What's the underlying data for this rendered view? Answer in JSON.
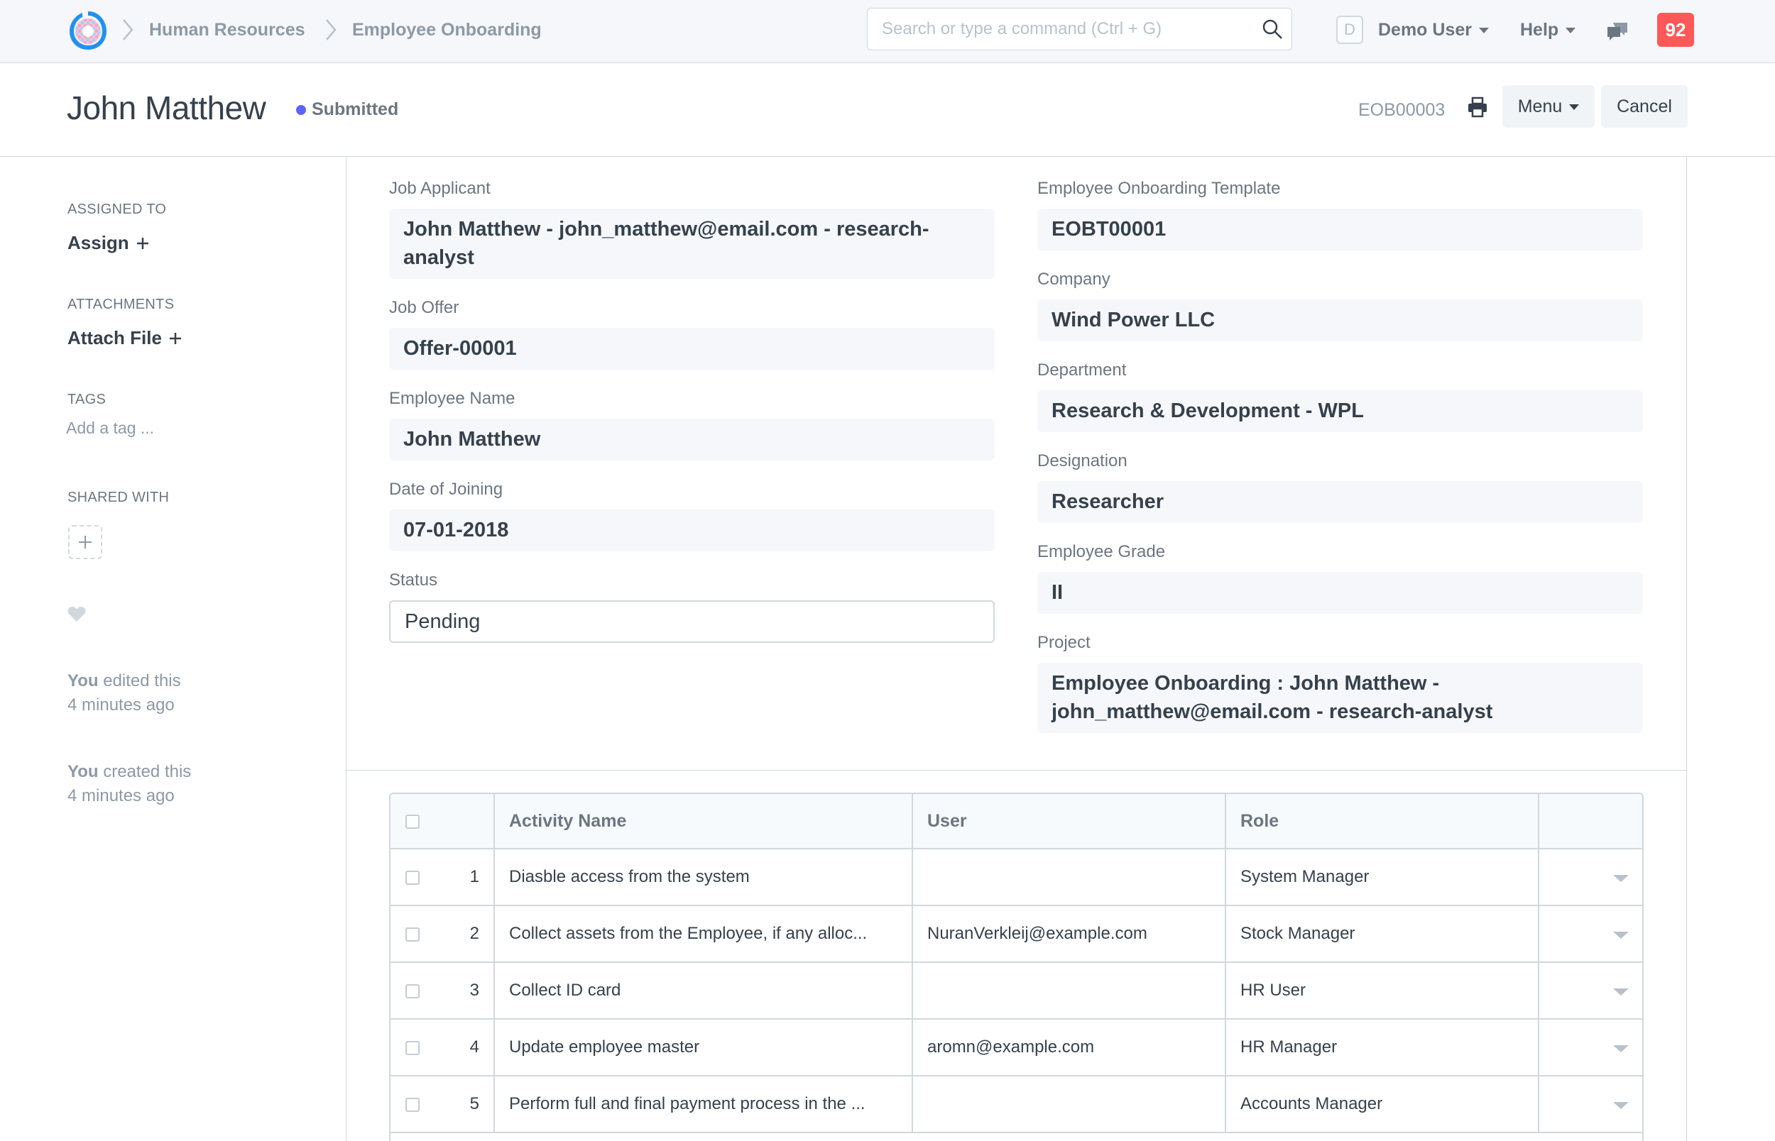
{
  "navbar": {
    "breadcrumbs": [
      "Human Resources",
      "Employee Onboarding"
    ],
    "search_placeholder": "Search or type a command (Ctrl + G)",
    "avatar_letter": "D",
    "user_menu": "Demo User",
    "help_menu": "Help",
    "notification_count": "92"
  },
  "page": {
    "title": "John Matthew",
    "status": "Submitted",
    "doc_id": "EOB00003",
    "menu_label": "Menu",
    "cancel_label": "Cancel"
  },
  "sidebar": {
    "assigned_to_heading": "Assigned To",
    "assign_label": "Assign",
    "attachments_heading": "Attachments",
    "attach_label": "Attach File",
    "tags_heading": "Tags",
    "tag_placeholder": "Add a tag ...",
    "shared_with_heading": "Shared With",
    "timeline": [
      {
        "who": "You",
        "action": "edited this",
        "when": "4 minutes ago"
      },
      {
        "who": "You",
        "action": "created this",
        "when": "4 minutes ago"
      }
    ]
  },
  "form": {
    "left": [
      {
        "label": "Job Applicant",
        "value": "John Matthew - john_matthew@email.com - research-analyst"
      },
      {
        "label": "Job Offer",
        "value": "Offer-00001"
      },
      {
        "label": "Employee Name",
        "value": "John Matthew"
      },
      {
        "label": "Date of Joining",
        "value": "07-01-2018"
      },
      {
        "label": "Status",
        "value": "Pending"
      }
    ],
    "right": [
      {
        "label": "Employee Onboarding Template",
        "value": "EOBT00001"
      },
      {
        "label": "Company",
        "value": "Wind Power LLC"
      },
      {
        "label": "Department",
        "value": "Research & Development - WPL"
      },
      {
        "label": "Designation",
        "value": "Researcher"
      },
      {
        "label": "Employee Grade",
        "value": "II"
      },
      {
        "label": "Project",
        "value": "Employee Onboarding : John Matthew - john_matthew@email.com - research-analyst"
      }
    ]
  },
  "activities": {
    "columns": [
      "Activity Name",
      "User",
      "Role"
    ],
    "rows": [
      {
        "idx": "1",
        "name": "Diasble access from the system",
        "user": "",
        "role": "System Manager"
      },
      {
        "idx": "2",
        "name": "Collect assets from the Employee, if any alloc...",
        "user": "NuranVerkleij@example.com",
        "role": "Stock Manager"
      },
      {
        "idx": "3",
        "name": "Collect ID card",
        "user": "",
        "role": "HR User"
      },
      {
        "idx": "4",
        "name": "Update employee master",
        "user": "aromn@example.com",
        "role": "HR Manager"
      },
      {
        "idx": "5",
        "name": "Perform full and final payment process in the ...",
        "user": "",
        "role": "Accounts Manager"
      }
    ]
  }
}
